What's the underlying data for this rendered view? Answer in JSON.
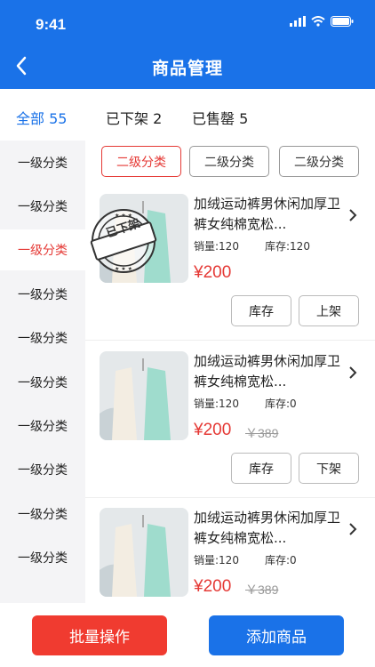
{
  "status_bar": {
    "time": "9:41"
  },
  "nav": {
    "title": "商品管理"
  },
  "tabs": [
    {
      "label": "全部 55"
    },
    {
      "label": "已下架 2"
    },
    {
      "label": "已售罄 5"
    }
  ],
  "sidebar": {
    "items": [
      "一级分类",
      "一级分类",
      "一级分类",
      "一级分类",
      "一级分类",
      "一级分类",
      "一级分类",
      "一级分类",
      "一级分类",
      "一级分类"
    ]
  },
  "subcategories": [
    "二级分类",
    "二级分类",
    "二级分类"
  ],
  "products": [
    {
      "name": "加绒运动裤男休闲加厚卫裤女纯棉宽松...",
      "sales": "销量:120",
      "stock": "库存:120",
      "price": "¥200",
      "original_price": "",
      "stamp": "已下架",
      "buttons": [
        "库存",
        "上架"
      ]
    },
    {
      "name": "加绒运动裤男休闲加厚卫裤女纯棉宽松...",
      "sales": "销量:120",
      "stock": "库存:0",
      "price": "¥200",
      "original_price": "￥389",
      "stamp": "",
      "buttons": [
        "库存",
        "下架"
      ]
    },
    {
      "name": "加绒运动裤男休闲加厚卫裤女纯棉宽松...",
      "sales": "销量:120",
      "stock": "库存:0",
      "price": "¥200",
      "original_price": "￥389",
      "stamp": "",
      "buttons": []
    }
  ],
  "footer": {
    "batch_label": "批量操作",
    "add_label": "添加商品"
  },
  "colors": {
    "primary": "#1a72e8",
    "accent": "#e53935",
    "background": "#f4f4f6"
  }
}
